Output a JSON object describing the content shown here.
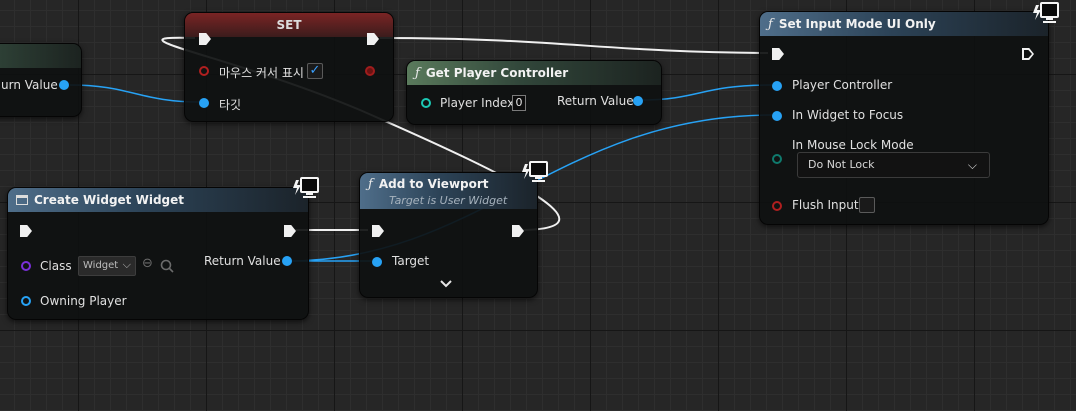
{
  "nodes": {
    "left_stub": {
      "return_label": "urn Value"
    },
    "set_node": {
      "title": "SET",
      "pin_mouse_cursor": "마우스 커서 표시",
      "pin_target": "타깃",
      "checkbox_mark": "✓"
    },
    "get_player_controller": {
      "title": "Get Player Controller",
      "player_index_label": "Player Index",
      "player_index_value": "0",
      "return_label": "Return Value"
    },
    "set_input_mode": {
      "title": "Set Input Mode UI Only",
      "player_controller": "Player Controller",
      "in_widget_to_focus": "In Widget to Focus",
      "in_mouse_lock_mode": "In Mouse Lock Mode",
      "lock_mode_value": "Do Not Lock",
      "flush_input": "Flush Input"
    },
    "create_widget": {
      "title": "Create Widget Widget",
      "class_label": "Class",
      "class_value": "Widget",
      "return_label": "Return Value",
      "owning_player": "Owning Player"
    },
    "add_to_viewport": {
      "title": "Add to Viewport",
      "subtitle": "Target is User Widget",
      "target": "Target"
    }
  },
  "icons": {
    "function": "ƒ",
    "chevron_down": "⌄",
    "dropdown_chevron": "⌵",
    "browse": "⊖",
    "search": "🔍"
  },
  "colors": {
    "exec_wire": "#f0f0f0",
    "object_wire": "#27a2f5",
    "set_header": "#7a2424",
    "pure_header": "#5a7a5c",
    "function_header": "#4f6e8a"
  }
}
